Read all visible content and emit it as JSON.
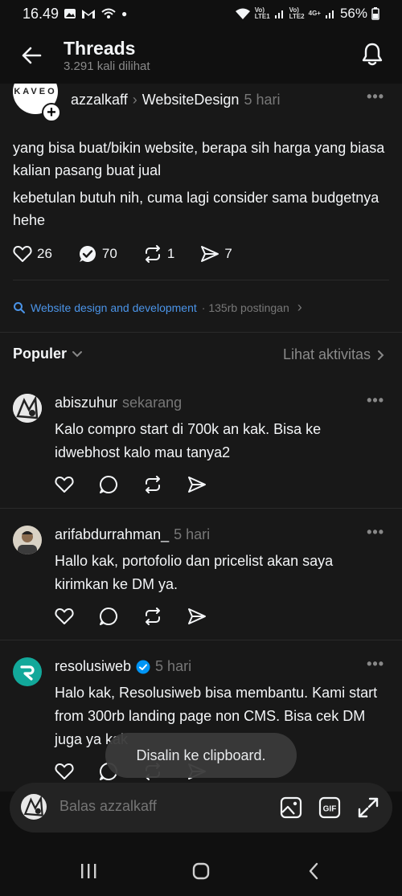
{
  "status_bar": {
    "time": "16.49",
    "network_1": "LTE1",
    "network_2": "LTE2",
    "network_2_type": "4G+",
    "battery": "56%"
  },
  "header": {
    "title": "Threads",
    "subtitle": "3.291 kali dilihat"
  },
  "post": {
    "avatar_text": "KAVEO",
    "username": "azzalkaff",
    "community": "WebsiteDesign",
    "time": "5 hari",
    "paragraph_1": "yang bisa buat/bikin website, berapa sih harga yang biasa kalian pasang buat jual",
    "paragraph_2": "kebetulan butuh nih, cuma lagi consider sama budgetnya hehe",
    "likes": "26",
    "replies": "70",
    "reposts": "1",
    "shares": "7"
  },
  "topic": {
    "name": "Website design and development",
    "count": "· 135rb postingan"
  },
  "section": {
    "sort_label": "Populer",
    "activity_label": "Lihat aktivitas"
  },
  "replies": [
    {
      "username": "abiszuhur",
      "time": "sekarang",
      "text": "Kalo compro start di 700k an kak. Bisa ke idwebhost kalo mau tanya2"
    },
    {
      "username": "arifabdurrahman_",
      "time": "5 hari",
      "text": "Hallo kak, portofolio dan pricelist akan saya kirimkan ke DM ya."
    },
    {
      "username": "resolusiweb",
      "time": "5 hari",
      "text": "Halo kak, Resolusiweb bisa membantu. Kami start from 300rb landing page non CMS. Bisa cek DM juga ya kak"
    }
  ],
  "toast": {
    "text": "Disalin ke clipboard."
  },
  "composer": {
    "placeholder": "Balas azzalkaff",
    "gif_label": "GIF"
  },
  "colors": {
    "background": "#181818",
    "text": "#f3f5f7",
    "muted": "#777777",
    "link": "#4b94e8",
    "verified": "#0095f6",
    "resolusiweb_brand": "#12a89a"
  }
}
